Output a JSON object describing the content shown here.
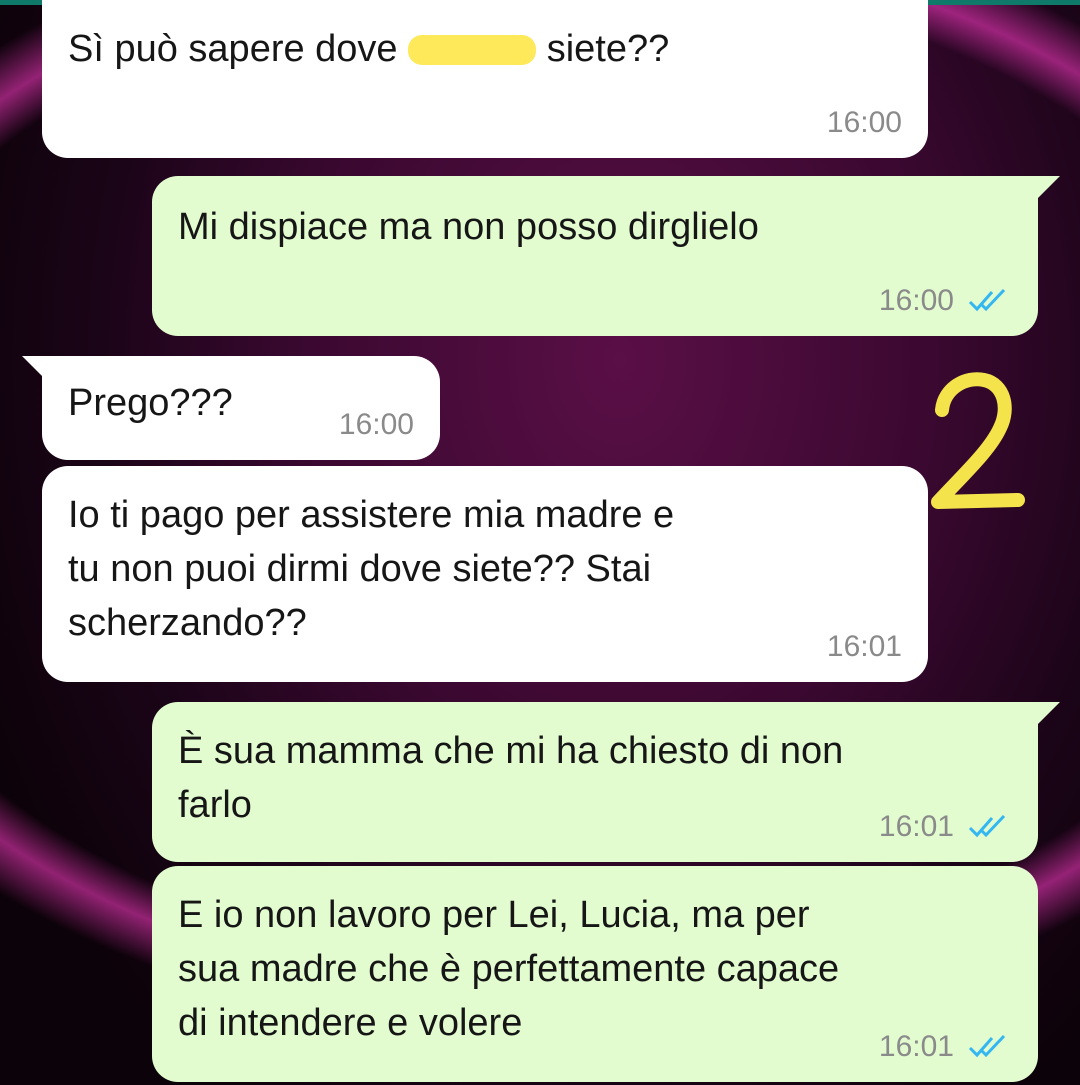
{
  "messages": [
    {
      "direction": "incoming",
      "text_before": "Sì può sapere dove ",
      "text_after": " siete??",
      "time": "16:00"
    },
    {
      "direction": "outgoing",
      "text": "Mi dispiace ma non posso dirglielo",
      "time": "16:00",
      "status": "read"
    },
    {
      "direction": "incoming",
      "text": "Prego???",
      "time": "16:00"
    },
    {
      "direction": "incoming",
      "text": "Io ti pago per assistere mia madre e\ntu non puoi dirmi dove siete?? Stai\nscherzando??",
      "time": "16:01"
    },
    {
      "direction": "outgoing",
      "text": "È sua mamma che mi ha chiesto di non\nfarlo",
      "time": "16:01",
      "status": "read"
    },
    {
      "direction": "outgoing",
      "text": "E io non lavoro per Lei, Lucia, ma per\nsua madre che è perfettamente capace\ndi intendere e volere",
      "time": "16:01",
      "status": "read"
    }
  ],
  "annotation": {
    "label": "2",
    "color": "#f5e34c"
  },
  "colors": {
    "incoming_bubble": "#ffffff",
    "outgoing_bubble": "#e2fcd0",
    "read_check": "#34b7f1",
    "time_text": "#8a8a8a"
  },
  "icons": {
    "read_receipt": "double-check-icon"
  }
}
